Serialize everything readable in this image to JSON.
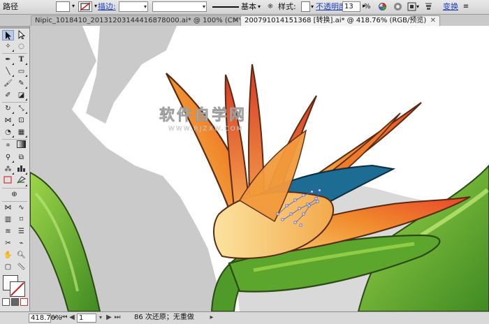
{
  "control_bar": {
    "object_type": "路径",
    "stroke_label": "描边:",
    "stroke_profile": "基本",
    "style_label": "样式:",
    "opacity_label": "不透明度:",
    "opacity_value": "13",
    "opacity_unit": "%",
    "transform_label": "变换"
  },
  "tabs": [
    {
      "label": "Nipic_1018410_20131203144416878000.ai* @ 100% (CMYK/预览)",
      "active": false
    },
    {
      "label": "200791014151368 [转换].ai* @ 418.76% (RGB/预览)",
      "active": true
    }
  ],
  "canvas": {
    "watermark_main": "软件自学网",
    "watermark_sub": "WWW.RJZXW.COM"
  },
  "status_bar": {
    "zoom": "418.76%",
    "page": "1",
    "status_text": "86 次还原；无重做"
  },
  "colors": {
    "flower_orange": "#f08a2c",
    "flower_red": "#e8452a",
    "flower_yellow": "#f9d070",
    "petal_blue": "#1d6c94",
    "leaf_green": "#5ca62e",
    "leaf_light": "#9ed64a",
    "outline": "#5a2a12",
    "artboard_gray": "#cacaca",
    "stroke_none_red": "#d01818",
    "link_blue": "#1f3fbf"
  },
  "icons": {
    "tools": [
      "selection-tool",
      "direct-selection-tool",
      "magic-wand-tool",
      "lasso-tool",
      "pen-tool",
      "type-tool",
      "line-tool",
      "rectangle-tool",
      "paintbrush-tool",
      "pencil-tool",
      "blob-brush-tool",
      "eraser-tool",
      "rotate-tool",
      "scale-tool",
      "width-tool",
      "free-transform-tool",
      "shape-builder-tool",
      "perspective-tool",
      "mesh-tool",
      "gradient-tool",
      "eyedropper-tool",
      "blend-tool",
      "symbol-sprayer-tool",
      "column-graph-tool",
      "artboard-tool",
      "slice-tool",
      "hand-tool",
      "zoom-tool"
    ]
  }
}
